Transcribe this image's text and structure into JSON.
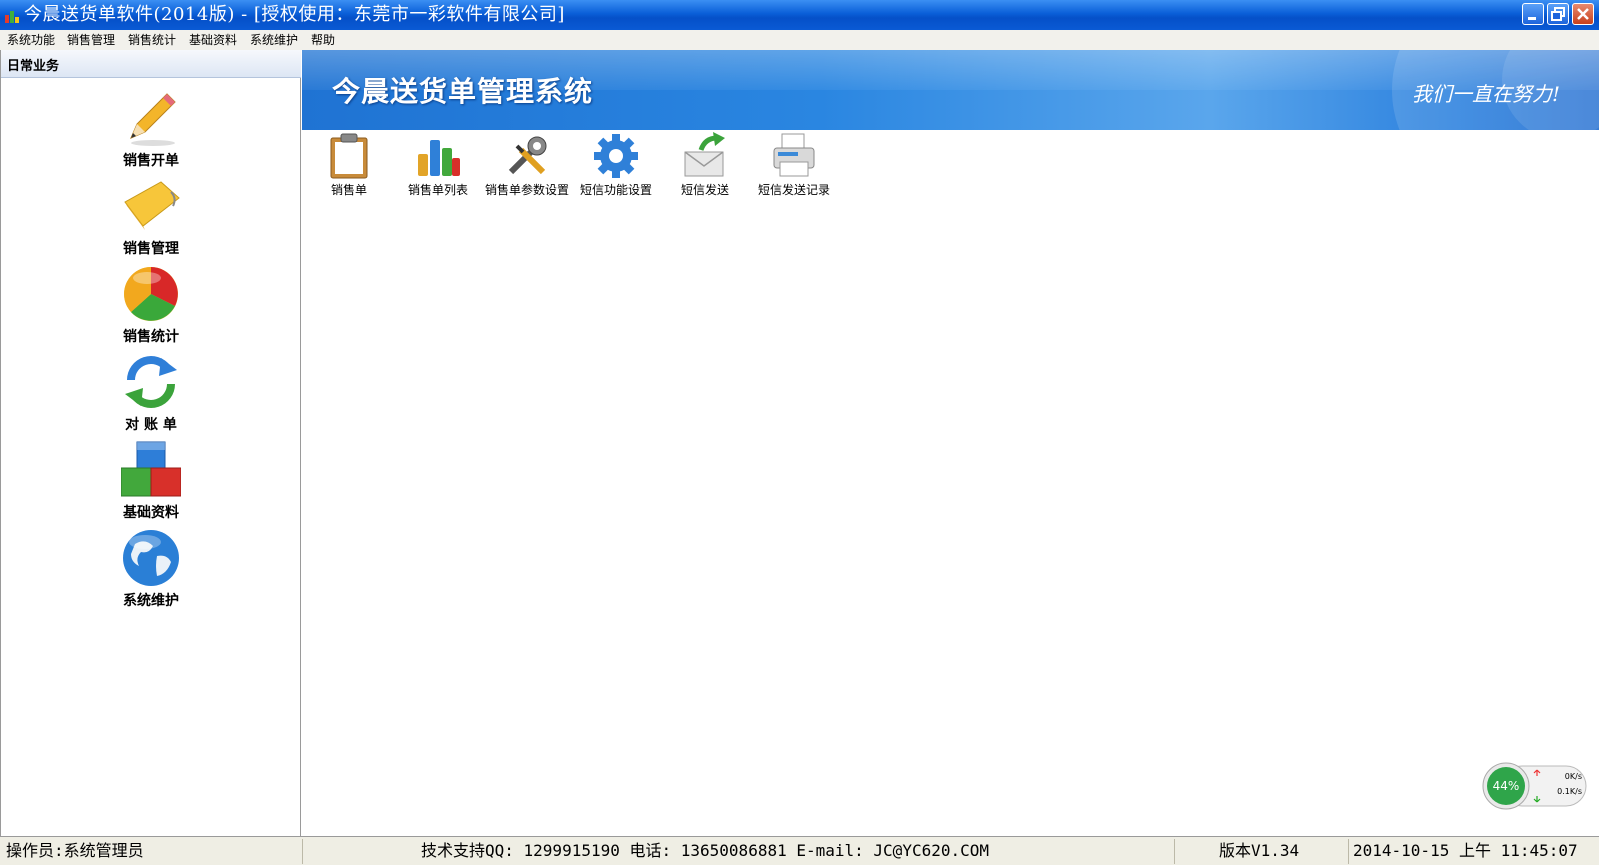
{
  "window": {
    "title": "今晨送货单软件(2014版) - [授权使用：东莞市一彩软件有限公司]"
  },
  "menu": [
    "系统功能",
    "销售管理",
    "销售统计",
    "基础资料",
    "系统维护",
    "帮助"
  ],
  "left_panel": {
    "header": "日常业务",
    "items": [
      {
        "label": "销售开单",
        "icon": "pencil-icon"
      },
      {
        "label": "销售管理",
        "icon": "folder-icon"
      },
      {
        "label": "销售统计",
        "icon": "pie-chart-icon"
      },
      {
        "label": "对 账 单",
        "icon": "refresh-arrows-icon"
      },
      {
        "label": "基础资料",
        "icon": "blocks-icon"
      },
      {
        "label": "系统维护",
        "icon": "globe-icon"
      }
    ]
  },
  "banner": {
    "title": "今晨送货单管理系统",
    "slogan": "我们一直在努力!"
  },
  "toolbar": [
    {
      "label": "销售单",
      "icon": "clipboard-icon"
    },
    {
      "label": "销售单列表",
      "icon": "bar-chart-icon"
    },
    {
      "label": "销售单参数设置",
      "icon": "tools-icon"
    },
    {
      "label": "短信功能设置",
      "icon": "gear-icon"
    },
    {
      "label": "短信发送",
      "icon": "envelope-send-icon"
    },
    {
      "label": "短信发送记录",
      "icon": "printer-icon"
    }
  ],
  "status": {
    "operator": "操作员:系统管理员",
    "support": "技术支持QQ: 1299915190   电话: 13650086881   E-mail: JC@YC620.COM",
    "version": "版本V1.34",
    "datetime": "2014-10-15 上午 11:45:07"
  },
  "network_widget": {
    "percent": "44%",
    "up": "0K/s",
    "down": "0.1K/s"
  },
  "colors": {
    "titlebar": "#0a5fd8",
    "banner": "#2a86e1",
    "statusbar": "#efeee4"
  }
}
